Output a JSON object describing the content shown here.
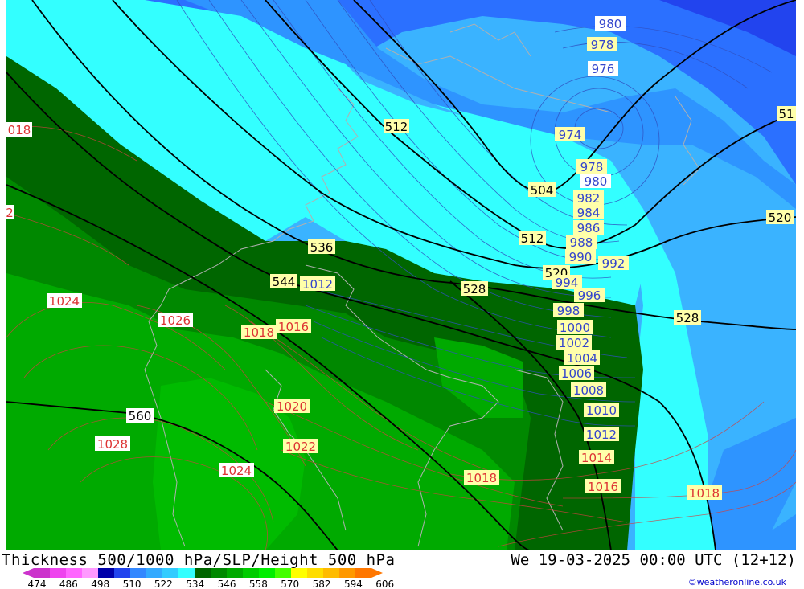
{
  "footer": {
    "title": "Thickness 500/1000 hPa/SLP/Height 500 hPa",
    "datetime": "We 19-03-2025 00:00 UTC (12+12)",
    "credit": "©weatheronline.co.uk"
  },
  "legend": {
    "ticks": [
      "474",
      "486",
      "498",
      "510",
      "522",
      "534",
      "546",
      "558",
      "570",
      "582",
      "594",
      "606"
    ],
    "colors": [
      "#cc33cc",
      "#ee44ee",
      "#ff66ff",
      "#ff99ff",
      "#0000aa",
      "#2244ee",
      "#3388ff",
      "#33aaff",
      "#33ccff",
      "#33ffff",
      "#006600",
      "#008800",
      "#00aa00",
      "#00cc00",
      "#00ee00",
      "#44ff00",
      "#ffff00",
      "#ffdd00",
      "#ffbb00",
      "#ff9900",
      "#ff7700"
    ]
  },
  "labels": {
    "height": [
      {
        "text": "512"
      },
      {
        "text": "504"
      },
      {
        "text": "512"
      },
      {
        "text": "536"
      },
      {
        "text": "544"
      },
      {
        "text": "528"
      },
      {
        "text": "520"
      },
      {
        "text": "528"
      },
      {
        "text": "560"
      },
      {
        "text": "520"
      },
      {
        "text": "51"
      }
    ],
    "slp_blue": [
      {
        "text": "980"
      },
      {
        "text": "978"
      },
      {
        "text": "976"
      },
      {
        "text": "974"
      },
      {
        "text": "978"
      },
      {
        "text": "980"
      },
      {
        "text": "982"
      },
      {
        "text": "984"
      },
      {
        "text": "986"
      },
      {
        "text": "988"
      },
      {
        "text": "990"
      },
      {
        "text": "992"
      },
      {
        "text": "994"
      },
      {
        "text": "996"
      },
      {
        "text": "998"
      },
      {
        "text": "1000"
      },
      {
        "text": "1002"
      },
      {
        "text": "1004"
      },
      {
        "text": "1006"
      },
      {
        "text": "1008"
      },
      {
        "text": "1010"
      },
      {
        "text": "1012"
      },
      {
        "text": "1012"
      }
    ],
    "slp_red": [
      {
        "text": "018"
      },
      {
        "text": "2"
      },
      {
        "text": "1024"
      },
      {
        "text": "1026"
      },
      {
        "text": "1018"
      },
      {
        "text": "1016"
      },
      {
        "text": "1020"
      },
      {
        "text": "1022"
      },
      {
        "text": "1028"
      },
      {
        "text": "1024"
      },
      {
        "text": "1018"
      },
      {
        "text": "1014"
      },
      {
        "text": "1016"
      },
      {
        "text": "1018"
      }
    ]
  }
}
